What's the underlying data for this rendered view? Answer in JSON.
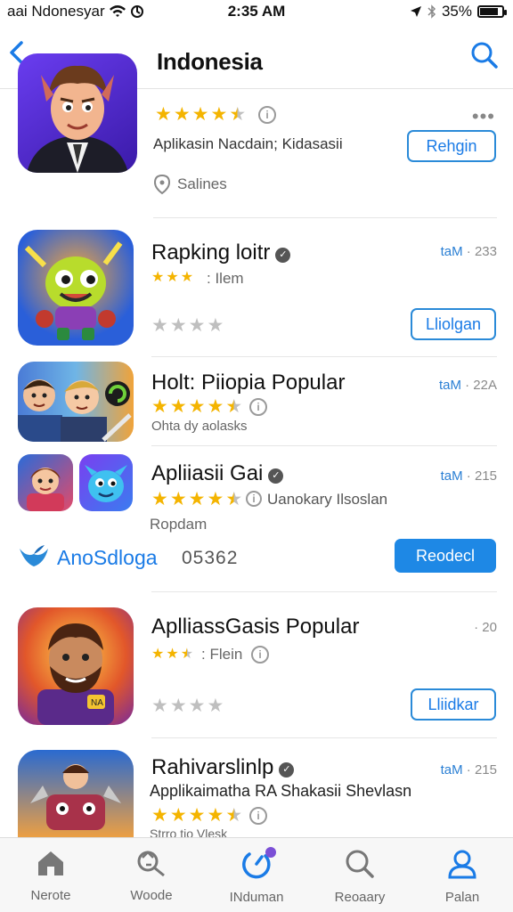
{
  "status_bar": {
    "carrier": "aai Ndonesyar",
    "time": "2:35 AM",
    "battery": "35%",
    "battery_level": 0.85
  },
  "nav": {
    "title": "Indonesia",
    "back_icon": "chevron-left-icon",
    "search_icon": "search-icon"
  },
  "apps": [
    {
      "rating_icon": "info-icon",
      "subtitle": "Aplikasin Nacdain; Kidasasii",
      "button": "Rehgin",
      "extra": "Salines",
      "more": "•••",
      "rating": 4.5
    },
    {
      "name": "Rapking loitr",
      "sub_rating_text": "Ilem",
      "meta_label": "taM",
      "meta_value": "· 233",
      "button": "Lliolgan"
    },
    {
      "name": "Holt: Piiopia Popular",
      "sub": "Ohta dy aolasks",
      "meta_label": "taM",
      "meta_value": "· 22A",
      "rating": 4.5
    },
    {
      "name": "Apliiasii Gai",
      "rating_text": "Uanokary Ilsoslan",
      "sub": "Ropdam",
      "meta_label": "taM",
      "meta_value": "· 215",
      "rating": 4.5
    },
    {
      "name": "AplliassGasis Popular",
      "sub_rating_text": "Flein",
      "meta_value": "· 20",
      "button": "Lliidkar"
    },
    {
      "name": "Rahivarslinlp",
      "sub": "Applikaimatha RA Shakasii Shevlasn",
      "sub2": "Strro tio Vlesk",
      "meta_label": "taM",
      "meta_value": "· 215",
      "rating": 4.5
    }
  ],
  "promo": {
    "brand": "AnoSdloga",
    "count": "05362",
    "button": "Reodecl"
  },
  "tabs": [
    {
      "label": "Nerote",
      "icon": "home-icon"
    },
    {
      "label": "Woode",
      "icon": "games-icon"
    },
    {
      "label": "INduman",
      "icon": "apps-icon"
    },
    {
      "label": "Reoaary",
      "icon": "search-icon"
    },
    {
      "label": "Palan",
      "icon": "profile-icon"
    }
  ],
  "colors": {
    "accent": "#1a7be6",
    "star": "#f4b400",
    "star_empty": "#bfbfbf",
    "button_solid": "#1e88e5"
  }
}
